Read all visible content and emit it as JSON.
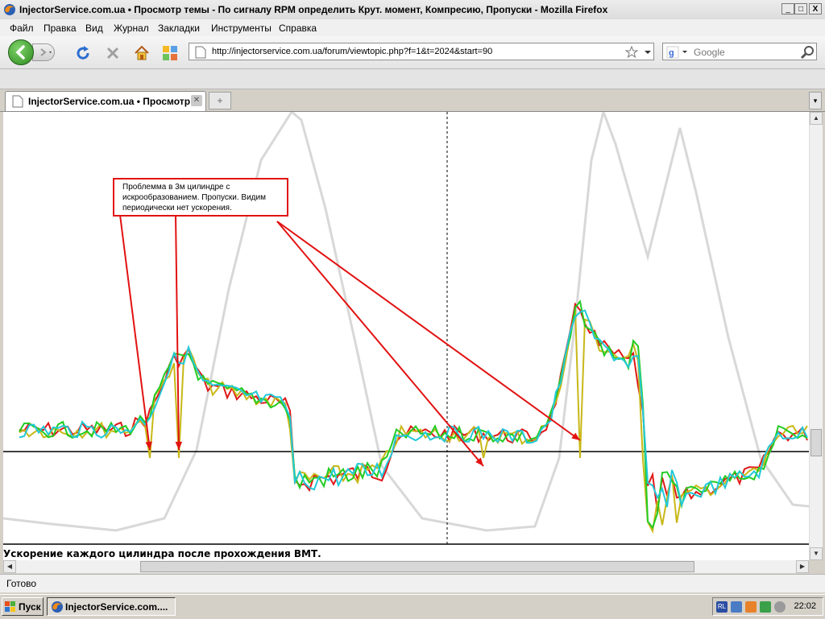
{
  "window": {
    "title": "InjectorService.com.ua • Просмотр темы - По сигналу RPM определить Крут. момент, Компресию, Пропуски - Mozilla Firefox",
    "controls": [
      "_",
      "□",
      "X"
    ]
  },
  "menu": [
    "Файл",
    "Правка",
    "Вид",
    "Журнал",
    "Закладки",
    "Инструменты",
    "Справка"
  ],
  "navbar": {
    "url": "http://injectorservice.com.ua/forum/viewtopic.php?f=1&t=2024&start=90",
    "search_placeholder": "Google"
  },
  "tabs": [
    {
      "label": "InjectorService.com.ua • Просмотр ...",
      "active": true
    }
  ],
  "content": {
    "annotation": " Проблемма в 3м цилиндре с искрообразованием. Пропуски. Видим периодически нет ускорения.",
    "caption": "Ускорение каждого цилиндра после прохождения ВМТ.",
    "colors": {
      "callout": "#e21212",
      "rpm_trace": "#d8d8d8",
      "series": [
        "#e01818",
        "#c8b818",
        "#22cc22",
        "#22c8d8"
      ]
    }
  },
  "status": {
    "text": "Готово"
  },
  "taskbar": {
    "start_label": "Пуск",
    "item_label": "InjectorService.com....",
    "lang": "RL",
    "clock": "22:02"
  }
}
